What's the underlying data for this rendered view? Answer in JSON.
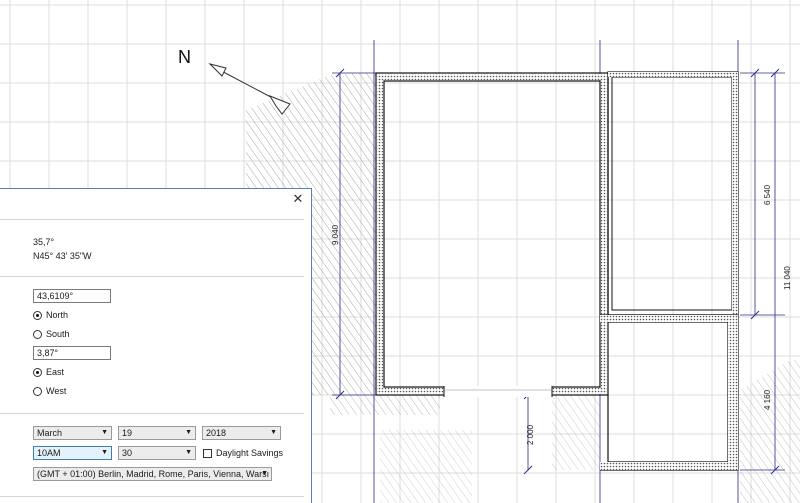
{
  "plan": {
    "north_label": "N",
    "dimensions": {
      "left_height": "9 040",
      "right_upper": "6 540",
      "right_total": "11 040",
      "right_lower": "4 160",
      "bottom_vertical": "2 000"
    },
    "colors": {
      "grid": "#dcdcdc",
      "dimension_line": "#2b2b8a",
      "wall": "#111111"
    }
  },
  "dialog": {
    "close_icon": "close-icon",
    "sun_angle": "35,7°",
    "sun_direction": "N45° 43' 35\"W",
    "latitude": "43,6109°",
    "north_label": "North",
    "south_label": "South",
    "latitude_selected": "North",
    "longitude": "3,87°",
    "east_label": "East",
    "west_label": "West",
    "longitude_selected": "East",
    "month": "March",
    "day": "19",
    "year": "2018",
    "hour": "10AM",
    "minute": "30",
    "daylight_label": "Daylight Savings",
    "daylight_checked": false,
    "timezone": "(GMT + 01:00) Berlin, Madrid, Rome, Paris, Vienna, Warsı"
  }
}
